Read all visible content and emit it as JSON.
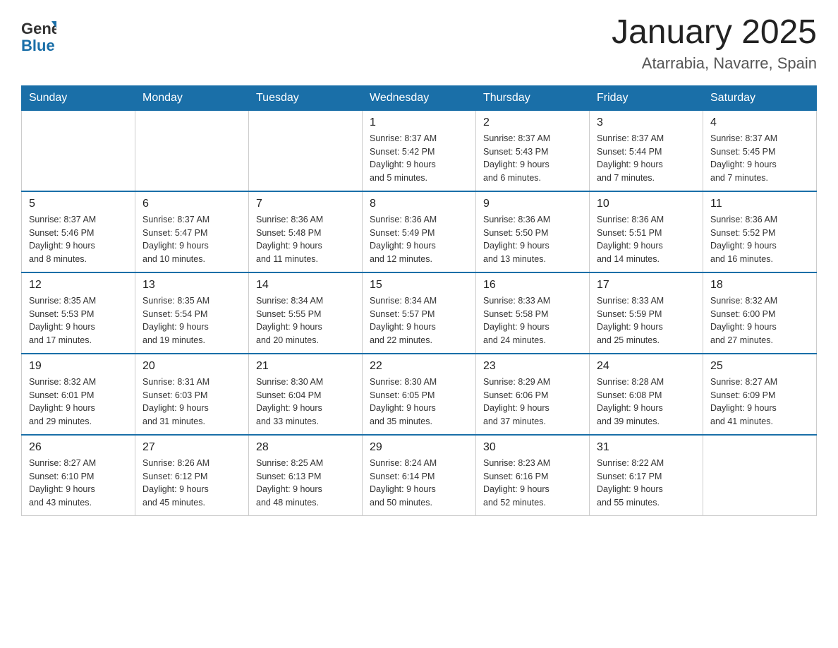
{
  "header": {
    "logo_general": "General",
    "logo_blue": "Blue",
    "month_title": "January 2025",
    "location": "Atarrabia, Navarre, Spain"
  },
  "weekdays": [
    "Sunday",
    "Monday",
    "Tuesday",
    "Wednesday",
    "Thursday",
    "Friday",
    "Saturday"
  ],
  "weeks": [
    [
      {
        "day": "",
        "info": ""
      },
      {
        "day": "",
        "info": ""
      },
      {
        "day": "",
        "info": ""
      },
      {
        "day": "1",
        "info": "Sunrise: 8:37 AM\nSunset: 5:42 PM\nDaylight: 9 hours\nand 5 minutes."
      },
      {
        "day": "2",
        "info": "Sunrise: 8:37 AM\nSunset: 5:43 PM\nDaylight: 9 hours\nand 6 minutes."
      },
      {
        "day": "3",
        "info": "Sunrise: 8:37 AM\nSunset: 5:44 PM\nDaylight: 9 hours\nand 7 minutes."
      },
      {
        "day": "4",
        "info": "Sunrise: 8:37 AM\nSunset: 5:45 PM\nDaylight: 9 hours\nand 7 minutes."
      }
    ],
    [
      {
        "day": "5",
        "info": "Sunrise: 8:37 AM\nSunset: 5:46 PM\nDaylight: 9 hours\nand 8 minutes."
      },
      {
        "day": "6",
        "info": "Sunrise: 8:37 AM\nSunset: 5:47 PM\nDaylight: 9 hours\nand 10 minutes."
      },
      {
        "day": "7",
        "info": "Sunrise: 8:36 AM\nSunset: 5:48 PM\nDaylight: 9 hours\nand 11 minutes."
      },
      {
        "day": "8",
        "info": "Sunrise: 8:36 AM\nSunset: 5:49 PM\nDaylight: 9 hours\nand 12 minutes."
      },
      {
        "day": "9",
        "info": "Sunrise: 8:36 AM\nSunset: 5:50 PM\nDaylight: 9 hours\nand 13 minutes."
      },
      {
        "day": "10",
        "info": "Sunrise: 8:36 AM\nSunset: 5:51 PM\nDaylight: 9 hours\nand 14 minutes."
      },
      {
        "day": "11",
        "info": "Sunrise: 8:36 AM\nSunset: 5:52 PM\nDaylight: 9 hours\nand 16 minutes."
      }
    ],
    [
      {
        "day": "12",
        "info": "Sunrise: 8:35 AM\nSunset: 5:53 PM\nDaylight: 9 hours\nand 17 minutes."
      },
      {
        "day": "13",
        "info": "Sunrise: 8:35 AM\nSunset: 5:54 PM\nDaylight: 9 hours\nand 19 minutes."
      },
      {
        "day": "14",
        "info": "Sunrise: 8:34 AM\nSunset: 5:55 PM\nDaylight: 9 hours\nand 20 minutes."
      },
      {
        "day": "15",
        "info": "Sunrise: 8:34 AM\nSunset: 5:57 PM\nDaylight: 9 hours\nand 22 minutes."
      },
      {
        "day": "16",
        "info": "Sunrise: 8:33 AM\nSunset: 5:58 PM\nDaylight: 9 hours\nand 24 minutes."
      },
      {
        "day": "17",
        "info": "Sunrise: 8:33 AM\nSunset: 5:59 PM\nDaylight: 9 hours\nand 25 minutes."
      },
      {
        "day": "18",
        "info": "Sunrise: 8:32 AM\nSunset: 6:00 PM\nDaylight: 9 hours\nand 27 minutes."
      }
    ],
    [
      {
        "day": "19",
        "info": "Sunrise: 8:32 AM\nSunset: 6:01 PM\nDaylight: 9 hours\nand 29 minutes."
      },
      {
        "day": "20",
        "info": "Sunrise: 8:31 AM\nSunset: 6:03 PM\nDaylight: 9 hours\nand 31 minutes."
      },
      {
        "day": "21",
        "info": "Sunrise: 8:30 AM\nSunset: 6:04 PM\nDaylight: 9 hours\nand 33 minutes."
      },
      {
        "day": "22",
        "info": "Sunrise: 8:30 AM\nSunset: 6:05 PM\nDaylight: 9 hours\nand 35 minutes."
      },
      {
        "day": "23",
        "info": "Sunrise: 8:29 AM\nSunset: 6:06 PM\nDaylight: 9 hours\nand 37 minutes."
      },
      {
        "day": "24",
        "info": "Sunrise: 8:28 AM\nSunset: 6:08 PM\nDaylight: 9 hours\nand 39 minutes."
      },
      {
        "day": "25",
        "info": "Sunrise: 8:27 AM\nSunset: 6:09 PM\nDaylight: 9 hours\nand 41 minutes."
      }
    ],
    [
      {
        "day": "26",
        "info": "Sunrise: 8:27 AM\nSunset: 6:10 PM\nDaylight: 9 hours\nand 43 minutes."
      },
      {
        "day": "27",
        "info": "Sunrise: 8:26 AM\nSunset: 6:12 PM\nDaylight: 9 hours\nand 45 minutes."
      },
      {
        "day": "28",
        "info": "Sunrise: 8:25 AM\nSunset: 6:13 PM\nDaylight: 9 hours\nand 48 minutes."
      },
      {
        "day": "29",
        "info": "Sunrise: 8:24 AM\nSunset: 6:14 PM\nDaylight: 9 hours\nand 50 minutes."
      },
      {
        "day": "30",
        "info": "Sunrise: 8:23 AM\nSunset: 6:16 PM\nDaylight: 9 hours\nand 52 minutes."
      },
      {
        "day": "31",
        "info": "Sunrise: 8:22 AM\nSunset: 6:17 PM\nDaylight: 9 hours\nand 55 minutes."
      },
      {
        "day": "",
        "info": ""
      }
    ]
  ]
}
